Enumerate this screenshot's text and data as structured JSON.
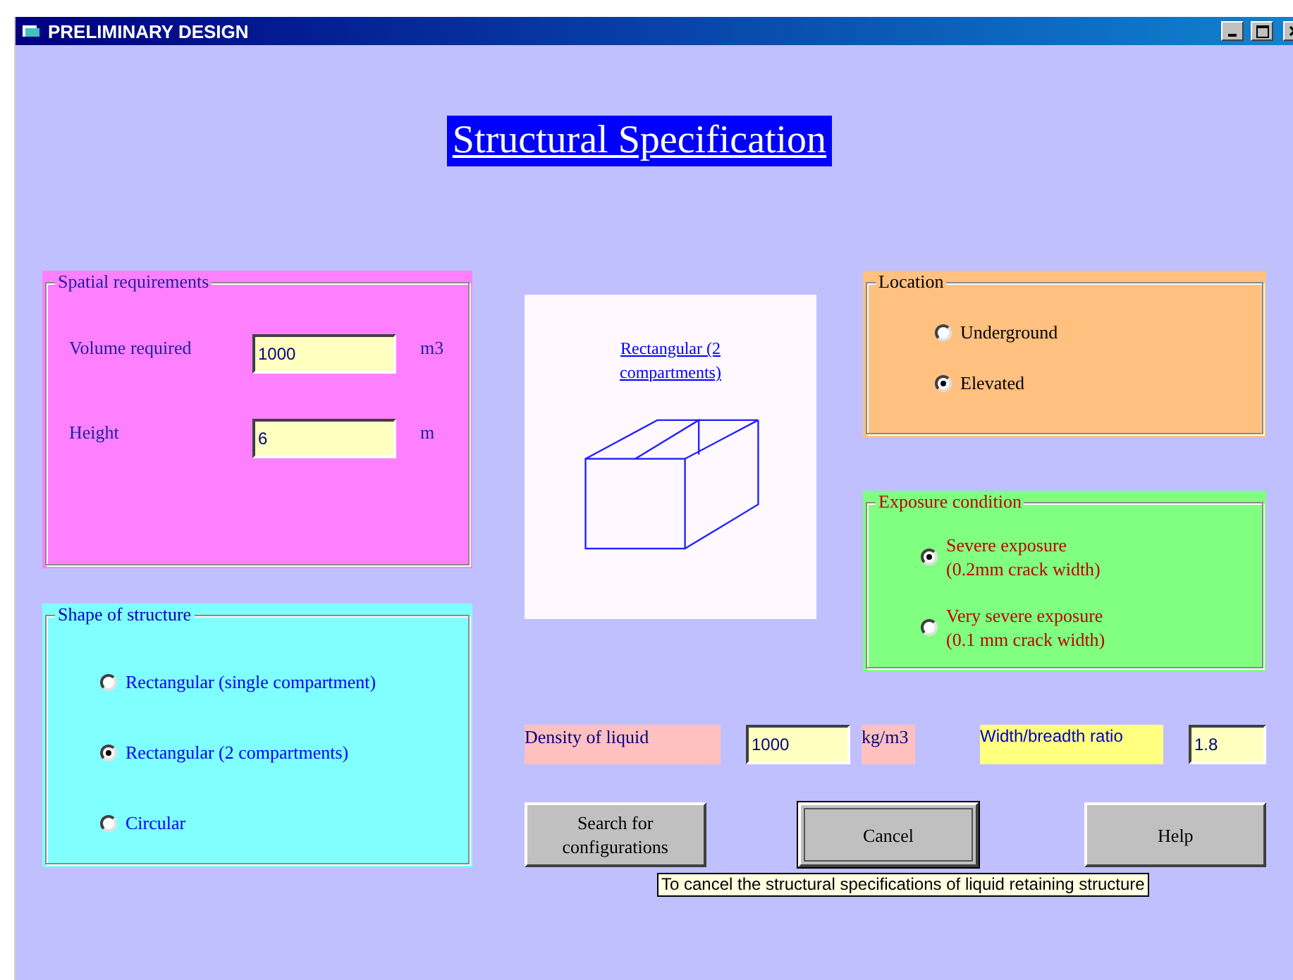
{
  "window": {
    "title": "PRELIMINARY DESIGN"
  },
  "heading": "Structural Specification",
  "spatial_requirements": {
    "title": "Spatial requirements",
    "fields": [
      {
        "label": "Volume required",
        "value": "1000",
        "unit": "m3"
      },
      {
        "label": "Height",
        "value": "6",
        "unit": "m"
      }
    ]
  },
  "shape_of_structure": {
    "title": "Shape of structure",
    "options": [
      {
        "label": "Rectangular (single compartment)",
        "selected": false
      },
      {
        "label": "Rectangular (2 compartments)",
        "selected": true
      },
      {
        "label": "Circular",
        "selected": false
      }
    ]
  },
  "preview": {
    "caption": "Rectangular (2 compartments)"
  },
  "location": {
    "title": "Location",
    "options": [
      {
        "label": "Underground",
        "selected": false
      },
      {
        "label": "Elevated",
        "selected": true
      }
    ]
  },
  "exposure_condition": {
    "title": "Exposure condition",
    "options": [
      {
        "label": "Severe exposure\n(0.2mm crack width)",
        "selected": true
      },
      {
        "label": "Very severe exposure\n(0.1 mm crack width)",
        "selected": false
      }
    ]
  },
  "liquid": {
    "density_label": "Density of liquid",
    "density_value": "1000",
    "density_unit": "kg/m3",
    "ratio_label": "Width/breadth ratio",
    "ratio_value": "1.8"
  },
  "buttons": [
    {
      "label": "Search for configurations",
      "focused": false
    },
    {
      "label": "Cancel",
      "focused": true
    },
    {
      "label": "Help",
      "focused": false
    }
  ],
  "tooltip": "To cancel the structural specifications of liquid retaining structure"
}
